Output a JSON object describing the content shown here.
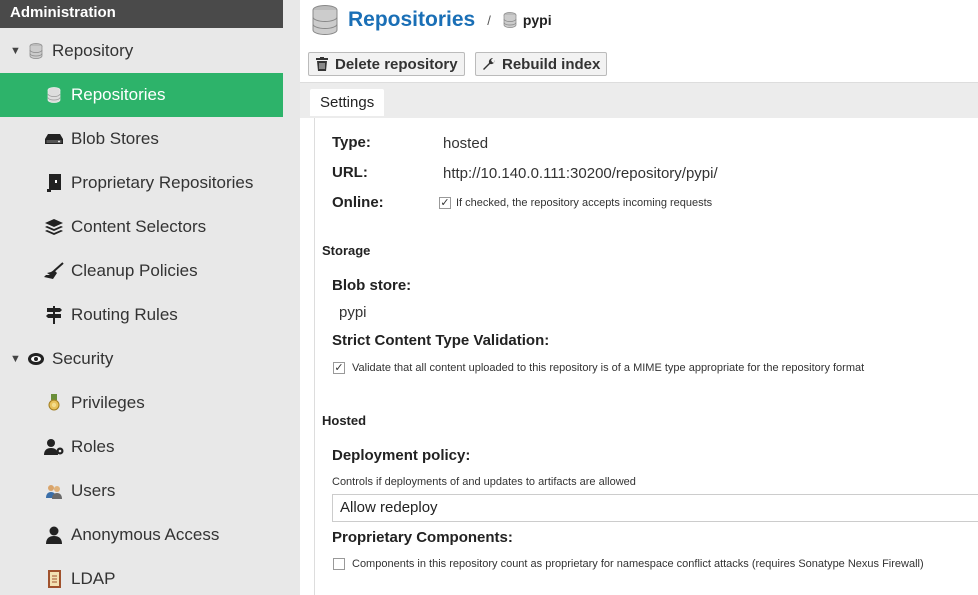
{
  "sidebar": {
    "header": "Administration",
    "groups": [
      {
        "label": "Repository",
        "icon": "database-icon"
      },
      {
        "label": "Security",
        "icon": "eye-badge-icon"
      }
    ],
    "items": [
      {
        "label": "Repositories",
        "icon": "database-icon",
        "active": true
      },
      {
        "label": "Blob Stores",
        "icon": "hard-drive-icon"
      },
      {
        "label": "Proprietary Repositories",
        "icon": "book-icon"
      },
      {
        "label": "Content Selectors",
        "icon": "layers-icon"
      },
      {
        "label": "Cleanup Policies",
        "icon": "broom-icon"
      },
      {
        "label": "Routing Rules",
        "icon": "signpost-icon"
      },
      {
        "label": "Privileges",
        "icon": "medal-icon"
      },
      {
        "label": "Roles",
        "icon": "user-gear-icon"
      },
      {
        "label": "Users",
        "icon": "users-icon"
      },
      {
        "label": "Anonymous Access",
        "icon": "user-icon"
      },
      {
        "label": "LDAP",
        "icon": "address-book-icon"
      }
    ],
    "active_color": "#2db36a"
  },
  "header": {
    "title": "Repositories",
    "separator": "/",
    "crumb": "pypi"
  },
  "toolbar": {
    "delete_label": "Delete repository",
    "rebuild_label": "Rebuild index"
  },
  "tabs": [
    "Settings"
  ],
  "settings": {
    "type_label": "Type:",
    "type_value": "hosted",
    "url_label": "URL:",
    "url_value": "http://10.140.0.111:30200/repository/pypi/",
    "online_label": "Online:",
    "online_checked": true,
    "online_hint": "If checked, the repository accepts incoming requests"
  },
  "storage": {
    "section": "Storage",
    "blob_label": "Blob store:",
    "blob_value": "pypi",
    "strict_label": "Strict Content Type Validation:",
    "strict_checked": true,
    "strict_hint": "Validate that all content uploaded to this repository is of a MIME type appropriate for the repository format"
  },
  "hosted": {
    "section": "Hosted",
    "deploy_label": "Deployment policy:",
    "deploy_hint": "Controls if deployments of and updates to artifacts are allowed",
    "deploy_value": "Allow redeploy",
    "prop_label": "Proprietary Components:",
    "prop_checked": false,
    "prop_hint": "Components in this repository count as proprietary for namespace conflict attacks (requires Sonatype Nexus Firewall)"
  },
  "colors": {
    "title": "#1a6fb6",
    "sidebar_header": "#4a4a4a"
  }
}
